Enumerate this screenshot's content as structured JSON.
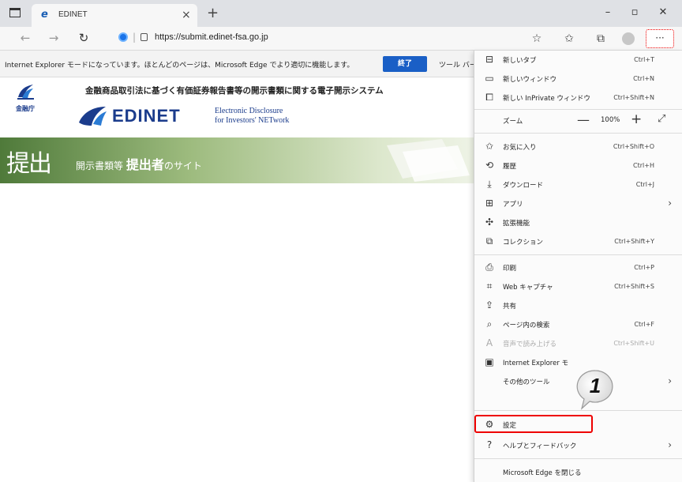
{
  "tab": {
    "title": "EDINET",
    "favicon": "ie-icon"
  },
  "window": {
    "minimize": "–",
    "maximize": "▫",
    "close": "✕"
  },
  "address_bar": {
    "url": "https://submit.edinet-fsa.go.jp"
  },
  "info_bar": {
    "message": "Internet Explorer モードになっています。ほとんどのページは、Microsoft Edge でより適切に機能します。",
    "end_button": "終了",
    "tools_label": "ツール バー"
  },
  "header": {
    "fsa_label": "金融庁",
    "system_title": "金融商品取引法に基づく有価証券報告書等の開示書類に関する電子開示システム",
    "edinet_word": "EDINET",
    "edinet_sub1": "Electronic Disclosure",
    "edinet_sub2": "for Investors' NETwork"
  },
  "banner": {
    "big": "提出",
    "small_prefix": "開示書類等",
    "small_bold": "提出者",
    "small_suffix": "のサイト"
  },
  "menu": {
    "new_tab": {
      "label": "新しいタブ",
      "shortcut": "Ctrl+T"
    },
    "new_window": {
      "label": "新しいウィンドウ",
      "shortcut": "Ctrl+N"
    },
    "inprivate": {
      "label": "新しい InPrivate ウィンドウ",
      "shortcut": "Ctrl+Shift+N"
    },
    "zoom": {
      "label": "ズーム",
      "value": "100%",
      "minus": "—",
      "plus": "+",
      "fullscreen": "⤢"
    },
    "favorites": {
      "label": "お気に入り",
      "shortcut": "Ctrl+Shift+O"
    },
    "history": {
      "label": "履歴",
      "shortcut": "Ctrl+H"
    },
    "downloads": {
      "label": "ダウンロード",
      "shortcut": "Ctrl+J"
    },
    "apps": {
      "label": "アプリ"
    },
    "extensions": {
      "label": "拡張機能"
    },
    "collections": {
      "label": "コレクション",
      "shortcut": "Ctrl+Shift+Y"
    },
    "print": {
      "label": "印刷",
      "shortcut": "Ctrl+P"
    },
    "web_capture": {
      "label": "Web キャプチャ",
      "shortcut": "Ctrl+Shift+S"
    },
    "share": {
      "label": "共有"
    },
    "find": {
      "label": "ページ内の検索",
      "shortcut": "Ctrl+F"
    },
    "read_aloud": {
      "label": "音声で読み上げる",
      "shortcut": "Ctrl+Shift+U"
    },
    "ie_mode": {
      "label": "Internet Explorer モ"
    },
    "more_tools": {
      "label": "その他のツール"
    },
    "settings": {
      "label": "設定"
    },
    "help": {
      "label": "ヘルプとフィードバック"
    },
    "close_edge": {
      "label": "Microsoft Edge を閉じる"
    }
  },
  "callout": {
    "number": "1"
  },
  "colors": {
    "accent": "#1a5fc6",
    "highlight": "#e00000",
    "banner_green": "#4f7a3a"
  }
}
